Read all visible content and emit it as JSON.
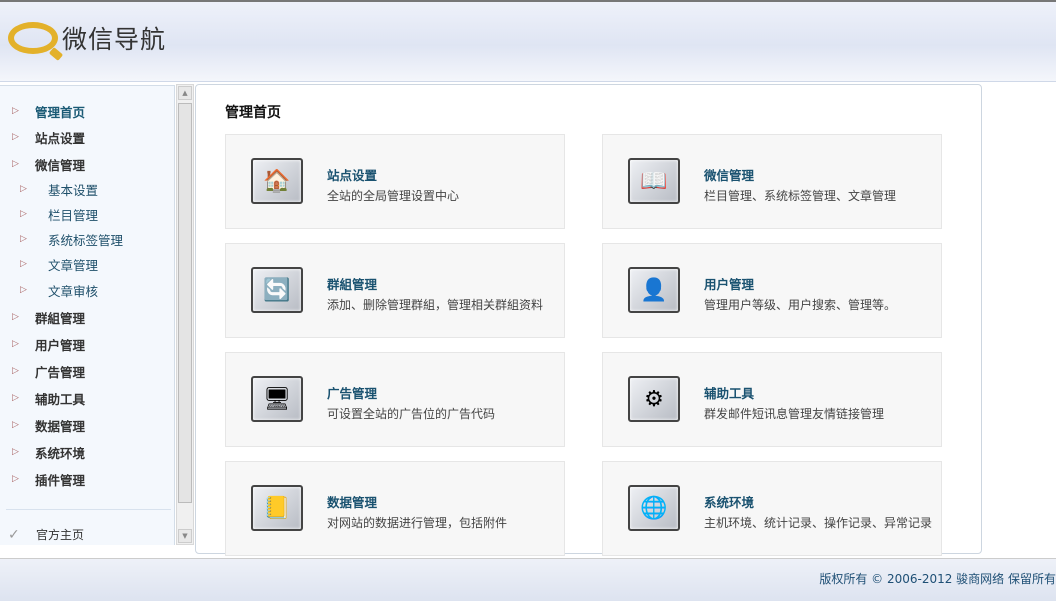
{
  "header": {
    "logo_text": "微信导航"
  },
  "sidebar": {
    "items": [
      {
        "label": "管理首页",
        "level": 0
      },
      {
        "label": "站点设置",
        "level": 0
      },
      {
        "label": "微信管理",
        "level": 0
      },
      {
        "label": "基本设置",
        "level": 1
      },
      {
        "label": "栏目管理",
        "level": 1
      },
      {
        "label": "系统标签管理",
        "level": 1
      },
      {
        "label": "文章管理",
        "level": 1
      },
      {
        "label": "文章审核",
        "level": 1
      },
      {
        "label": "群組管理",
        "level": 0
      },
      {
        "label": "用户管理",
        "level": 0
      },
      {
        "label": "广告管理",
        "level": 0
      },
      {
        "label": "辅助工具",
        "level": 0
      },
      {
        "label": "数据管理",
        "level": 0
      },
      {
        "label": "系统环境",
        "level": 0
      },
      {
        "label": "插件管理",
        "level": 0
      }
    ],
    "home_link": "官方主页"
  },
  "main": {
    "title": "管理首页",
    "cards": [
      {
        "title": "站点设置",
        "desc": "全站的全局管理设置中心",
        "icon": "house-icon"
      },
      {
        "title": "微信管理",
        "desc": "栏目管理、系统标签管理、文章管理",
        "icon": "notebook-icon"
      },
      {
        "title": "群組管理",
        "desc": "添加、删除管理群組，管理相关群組资料",
        "icon": "group-icon"
      },
      {
        "title": "用户管理",
        "desc": "管理用户等级、用户搜索、管理等。",
        "icon": "user-icon"
      },
      {
        "title": "广告管理",
        "desc": "可设置全站的广告位的广告代码",
        "icon": "monitor-icon"
      },
      {
        "title": "辅助工具",
        "desc": "群发邮件短讯息管理友情链接管理",
        "icon": "gear-icon"
      },
      {
        "title": "数据管理",
        "desc": "对网站的数据进行管理，包括附件",
        "icon": "database-icon"
      },
      {
        "title": "系统环境",
        "desc": "主机环境、统计记录、操作记录、异常记录",
        "icon": "globe-icon"
      }
    ]
  },
  "footer": {
    "copyright": "版权所有 © 2006-2012 骏商网络 保留所有"
  }
}
